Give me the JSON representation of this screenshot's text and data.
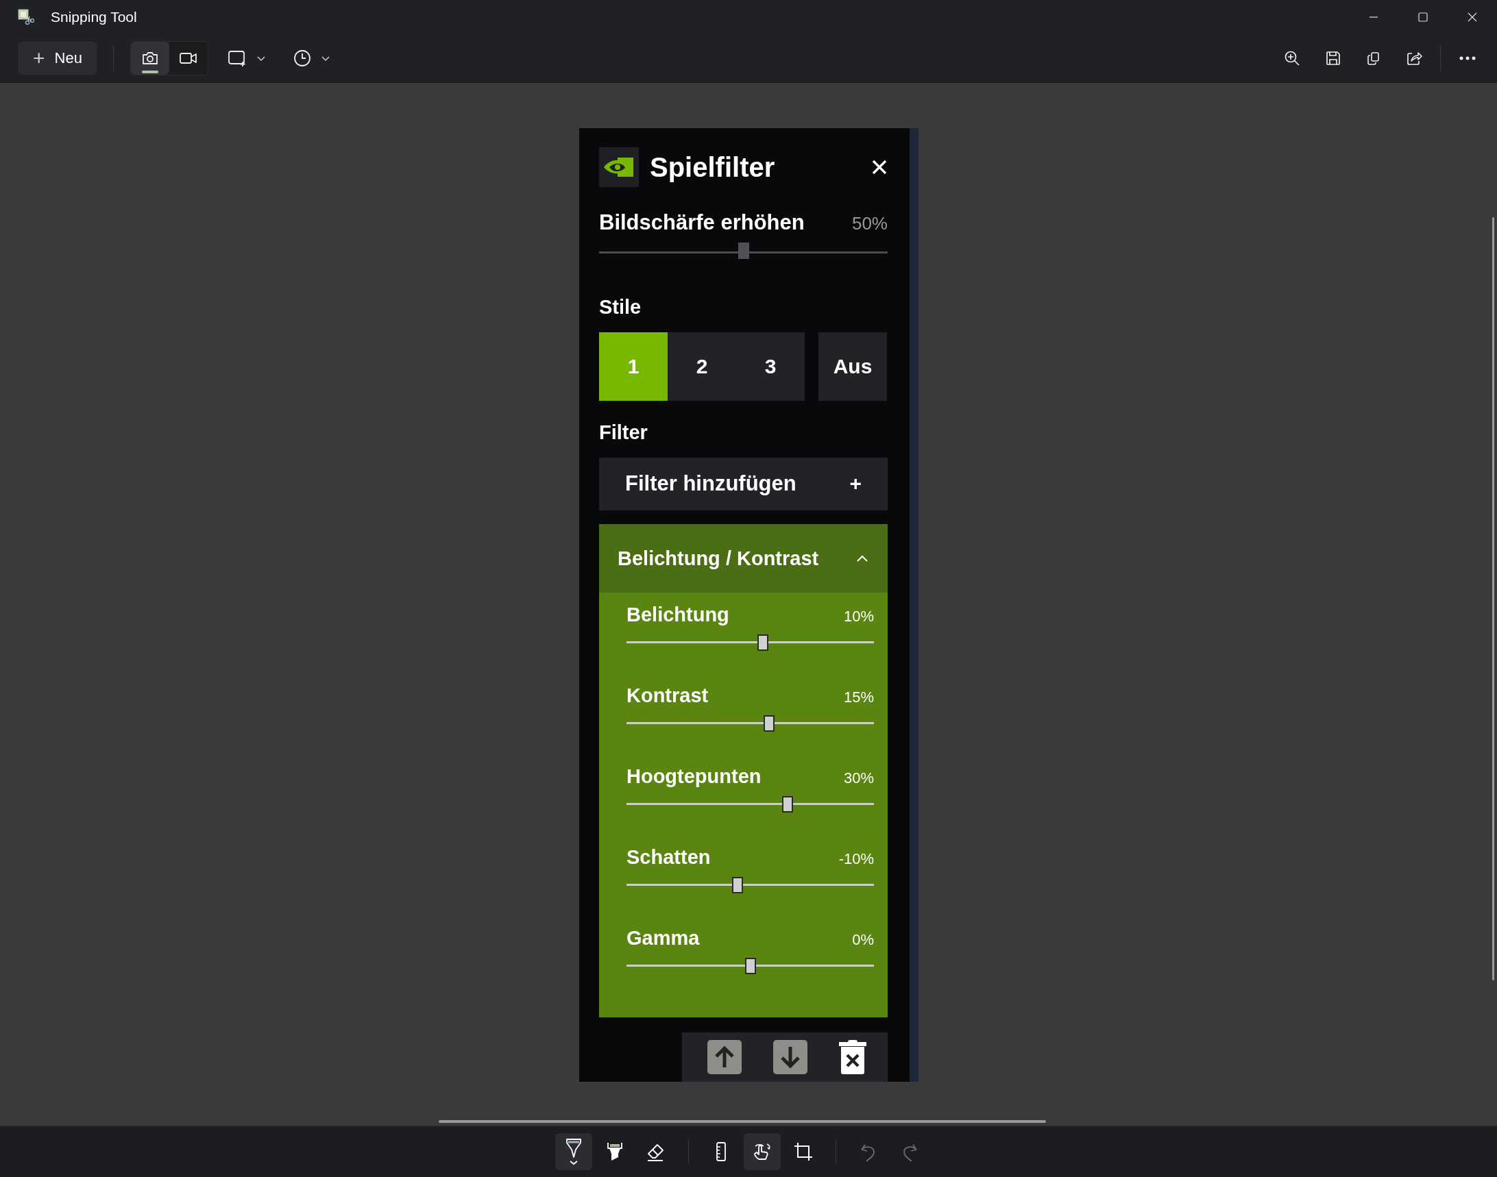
{
  "window": {
    "title": "Snipping Tool"
  },
  "toolbar": {
    "new_button": {
      "label": "Neu",
      "icon": "+"
    },
    "modes": [
      {
        "kind": "photo",
        "selected": true
      },
      {
        "kind": "video",
        "selected": false
      }
    ]
  },
  "panel": {
    "title": "Spielfilter",
    "sharpen": {
      "label": "Bildschärfe erhöhen",
      "reading": "50%",
      "level": 0.5
    },
    "styles_label": "Stile",
    "styles": [
      {
        "label": "1",
        "selected": true
      },
      {
        "label": "2",
        "selected": false
      },
      {
        "label": "3",
        "selected": false
      }
    ],
    "off_button": {
      "label": "Aus",
      "selected": false
    },
    "filter_label": "Filter",
    "add_filter": {
      "label": "Filter hinzufügen",
      "icon": "+"
    },
    "section": {
      "title": "Belichtung / Kontrast",
      "expanded": true,
      "sliders": [
        {
          "label": "Belichtung",
          "reading": "10%",
          "level": 0.55
        },
        {
          "label": "Kontrast",
          "reading": "15%",
          "level": 0.575
        },
        {
          "label": "Hoogtepunten",
          "reading": "30%",
          "level": 0.65
        },
        {
          "label": "Schatten",
          "reading": "-10%",
          "level": 0.45
        },
        {
          "label": "Gamma",
          "reading": "0%",
          "level": 0.5
        }
      ]
    }
  },
  "drawing_toolbar": {
    "groups": [
      {
        "tools": [
          {
            "kind": "pen",
            "selected": true,
            "disabled": false
          },
          {
            "kind": "highlighter",
            "selected": false,
            "disabled": false
          },
          {
            "kind": "eraser",
            "selected": false,
            "disabled": false
          }
        ]
      },
      {
        "tools": [
          {
            "kind": "ruler",
            "selected": false,
            "disabled": false
          },
          {
            "kind": "touch",
            "selected": true,
            "disabled": false
          },
          {
            "kind": "crop",
            "selected": false,
            "disabled": false
          }
        ]
      },
      {
        "tools": [
          {
            "kind": "undo",
            "disabled": true
          },
          {
            "kind": "redo",
            "disabled": true
          }
        ]
      }
    ]
  }
}
